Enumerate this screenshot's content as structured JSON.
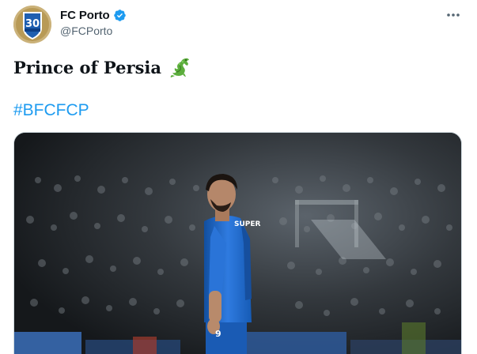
{
  "tweet": {
    "author": {
      "display_name": "FC Porto",
      "handle": "@FCPorto",
      "avatar_text": "30",
      "verified": true
    },
    "text": "Prince of Persia",
    "emoji": "dragon-icon",
    "hashtag": "#BFCFCP",
    "media": {
      "description_label": "player-photo",
      "jersey_text": "SUPER",
      "number": "9"
    }
  },
  "colors": {
    "verified": "#1d9bf0",
    "link": "#1d9bf0",
    "text": "#0f1419",
    "secondary": "#536471",
    "kit_blue": "#1f6fd6",
    "dragon_green": "#5cae3c"
  },
  "icons": {
    "more": "more-horizontal-icon",
    "verified": "verified-badge-icon"
  }
}
